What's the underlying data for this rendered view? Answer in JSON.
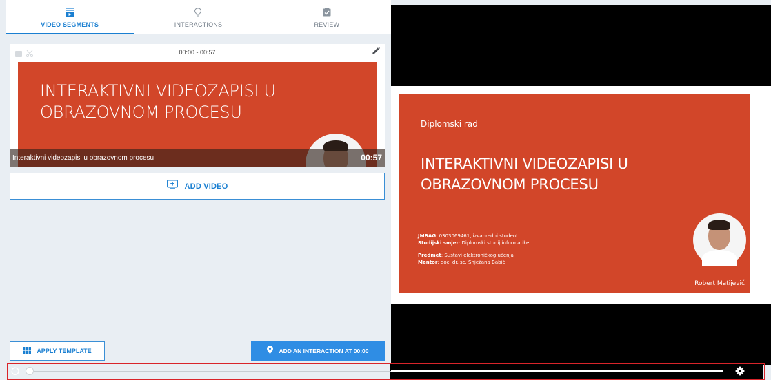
{
  "tabs": [
    {
      "label": "VIDEO SEGMENTS",
      "active": true,
      "icon": "video-segments-icon"
    },
    {
      "label": "INTERACTIONS",
      "active": false,
      "icon": "lightbulb-icon"
    },
    {
      "label": "REVIEW",
      "active": false,
      "icon": "checkbox-icon"
    }
  ],
  "segment": {
    "time_range": "00:00 - 00:57",
    "thumbnail_title_line1": "INTERAKTIVNI VIDEOZAPISI U",
    "thumbnail_title_line2": "OBRAZOVNOM PROCESU",
    "caption": "Interaktivni videozapisi u obrazovnom procesu",
    "duration": "00:57"
  },
  "add_video_label": "ADD VIDEO",
  "apply_template_label": "APPLY TEMPLATE",
  "add_interaction_label": "ADD AN INTERACTION AT 00:00",
  "slide": {
    "subtitle": "Diplomski rad",
    "title_line1": "INTERAKTIVNI VIDEOZAPISI U",
    "title_line2": "OBRAZOVNOM PROCESU",
    "jmbag_label": "JMBAG",
    "jmbag_value": ": 0303069461, izvanredni student",
    "smjer_label": "Studijski smjer",
    "smjer_value": ": Diplomski studij informatike",
    "predmet_label": "Predmet",
    "predmet_value": ": Sustavi elektroničkog učenja",
    "mentor_label": "Mentor",
    "mentor_value": ": doc. dr. sc. Snježana Babić",
    "author": "Robert Matijević"
  },
  "colors": {
    "accent": "#1a7fd1",
    "slide_red": "#d24629",
    "panel_bg": "#e9eef3",
    "highlight_border": "#d9242a"
  },
  "player": {
    "progress": 0
  }
}
